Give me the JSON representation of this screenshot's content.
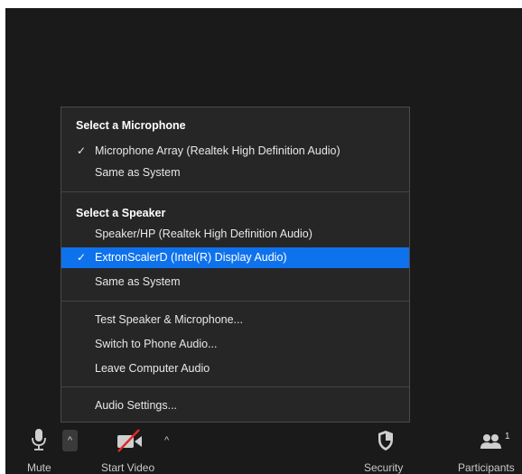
{
  "menu": {
    "mic_header": "Select a Microphone",
    "mic_items": [
      {
        "label": "Microphone Array (Realtek High Definition Audio)",
        "checked": true
      },
      {
        "label": "Same as System",
        "checked": false
      }
    ],
    "speaker_header": "Select a Speaker",
    "speaker_items": [
      {
        "label": "Speaker/HP (Realtek High Definition Audio)",
        "checked": false
      },
      {
        "label": "ExtronScalerD (Intel(R) Display Audio)",
        "checked": true
      },
      {
        "label": "Same as System",
        "checked": false
      }
    ],
    "actions": [
      "Test Speaker & Microphone...",
      "Switch to Phone Audio...",
      "Leave Computer Audio"
    ],
    "settings": "Audio Settings...",
    "check_glyph": "✓"
  },
  "toolbar": {
    "mute_label": "Mute",
    "video_label": "Start Video",
    "security_label": "Security",
    "participants_label": "Participants",
    "participants_count": "1",
    "caret_glyph": "^"
  },
  "colors": {
    "selected_bg": "#0e72ed",
    "video_off_slash": "#e02828",
    "background": "#1a1a1a",
    "menu_bg": "#262626"
  },
  "icons": [
    "microphone-icon",
    "camera-off-icon",
    "shield-icon",
    "participants-icon",
    "checkmark-icon",
    "caret-up-icon"
  ]
}
